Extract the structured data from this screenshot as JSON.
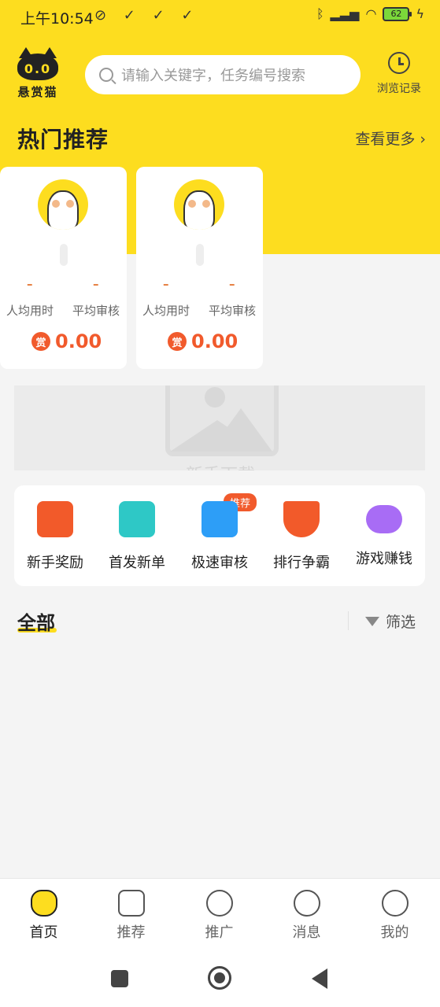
{
  "status_bar": {
    "time": "上午10:54",
    "left_icons": "⊘ ✓ ✓ ✓",
    "battery": "62"
  },
  "header": {
    "logo_text": "悬赏猫",
    "logo_eyes": "0.0",
    "search_placeholder": "请输入关键字，任务编号搜索",
    "history_label": "浏览记录"
  },
  "hot": {
    "title": "热门推荐",
    "see_more": "查看更多",
    "cards": [
      {
        "dash1": "–",
        "dash2": "–",
        "label1": "人均用时",
        "label2": "平均审核",
        "reward_badge": "赏",
        "reward": "0.00"
      },
      {
        "dash1": "–",
        "dash2": "–",
        "label1": "人均用时",
        "label2": "平均审核",
        "reward_badge": "赏",
        "reward": "0.00"
      }
    ]
  },
  "banner": {
    "text": "新手下载"
  },
  "quick_menu": {
    "badge": "推荐",
    "items": [
      {
        "label": "新手奖励",
        "icon": "red-envelope-icon",
        "color": "#f25a2a"
      },
      {
        "label": "首发新单",
        "icon": "new-tag-icon",
        "color": "#2ec8c6"
      },
      {
        "label": "极速审核",
        "icon": "fast-review-icon",
        "color": "#2d9ef7"
      },
      {
        "label": "排行争霸",
        "icon": "trophy-icon",
        "color": "#f25a2a"
      },
      {
        "label": "游戏赚钱",
        "icon": "gamepad-icon",
        "color": "#a86cf5"
      }
    ]
  },
  "all_section": {
    "title": "全部",
    "filter": "筛选"
  },
  "tabbar": {
    "items": [
      {
        "label": "首页"
      },
      {
        "label": "推荐"
      },
      {
        "label": "推广"
      },
      {
        "label": "消息"
      },
      {
        "label": "我的"
      }
    ]
  }
}
